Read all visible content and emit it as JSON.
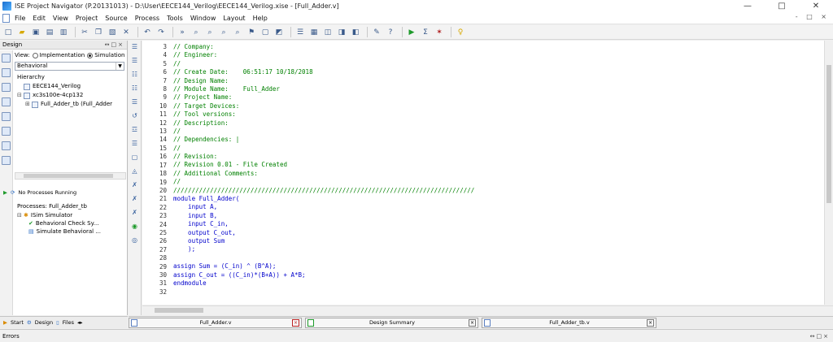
{
  "window": {
    "title": "ISE Project Navigator (P.20131013) - D:\\User\\EECE144_Verilog\\EECE144_Verilog.xise - [Full_Adder.v]",
    "minimize": "—",
    "maximize": "□",
    "close": "✕"
  },
  "menu": {
    "items": [
      "File",
      "Edit",
      "View",
      "Project",
      "Source",
      "Process",
      "Tools",
      "Window",
      "Layout",
      "Help"
    ],
    "mdi_controls": "- □ ×"
  },
  "design_panel": {
    "header": "Design",
    "header_controls": "↔□×",
    "view_label": "View:",
    "view_implementation": "Implementation",
    "view_simulation": "Simulation",
    "selected_view": "Simulation",
    "dropdown_value": "Behavioral",
    "hierarchy_label": "Hierarchy",
    "tree": [
      {
        "toggle": "",
        "label": "EECE144_Verilog"
      },
      {
        "toggle": "⊟",
        "label": "xc3s100e-4cp132"
      },
      {
        "toggle": "⊞",
        "label": "Full_Adder_tb (Full_Adder"
      }
    ]
  },
  "processes": {
    "status": "No Processes Running",
    "label": "Processes: Full_Adder_tb",
    "tree": [
      {
        "toggle": "⊟",
        "label": "ISim Simulator"
      },
      {
        "toggle": "",
        "label": "Behavioral Check Sy..."
      },
      {
        "toggle": "",
        "label": "Simulate Behavioral ..."
      }
    ]
  },
  "editor": {
    "lines": [
      {
        "num": "3",
        "text": "// Company:",
        "kind": "comment"
      },
      {
        "num": "4",
        "text": "// Engineer:",
        "kind": "comment"
      },
      {
        "num": "5",
        "text": "//",
        "kind": "comment"
      },
      {
        "num": "6",
        "text": "// Create Date:    06:51:17 10/18/2018",
        "kind": "comment"
      },
      {
        "num": "7",
        "text": "// Design Name:",
        "kind": "comment"
      },
      {
        "num": "8",
        "text": "// Module Name:    Full_Adder",
        "kind": "comment"
      },
      {
        "num": "9",
        "text": "// Project Name:",
        "kind": "comment"
      },
      {
        "num": "10",
        "text": "// Target Devices:",
        "kind": "comment"
      },
      {
        "num": "11",
        "text": "// Tool versions:",
        "kind": "comment"
      },
      {
        "num": "12",
        "text": "// Description:",
        "kind": "comment"
      },
      {
        "num": "13",
        "text": "//",
        "kind": "comment"
      },
      {
        "num": "14",
        "text": "// Dependencies: |",
        "kind": "comment"
      },
      {
        "num": "15",
        "text": "//",
        "kind": "comment"
      },
      {
        "num": "16",
        "text": "// Revision:",
        "kind": "comment"
      },
      {
        "num": "17",
        "text": "// Revision 0.01 - File Created",
        "kind": "comment"
      },
      {
        "num": "18",
        "text": "// Additional Comments:",
        "kind": "comment"
      },
      {
        "num": "19",
        "text": "//",
        "kind": "comment"
      },
      {
        "num": "20",
        "text": "//////////////////////////////////////////////////////////////////////////////////",
        "kind": "comment"
      },
      {
        "num": "21",
        "text": "module Full_Adder(",
        "kind": "keyword"
      },
      {
        "num": "22",
        "text": "    input A,",
        "kind": "keyword"
      },
      {
        "num": "23",
        "text": "    input B,",
        "kind": "keyword"
      },
      {
        "num": "24",
        "text": "    input C_in,",
        "kind": "keyword"
      },
      {
        "num": "25",
        "text": "    output C_out,",
        "kind": "keyword"
      },
      {
        "num": "26",
        "text": "    output Sum",
        "kind": "keyword"
      },
      {
        "num": "27",
        "text": "    );",
        "kind": "keyword"
      },
      {
        "num": "28",
        "text": "",
        "kind": "text"
      },
      {
        "num": "29",
        "text": "assign Sum = (C_in) ^ (B^A);",
        "kind": "keyword"
      },
      {
        "num": "30",
        "text": "assign C_out = ((C_in)*(B+A)) + A*B;",
        "kind": "keyword"
      },
      {
        "num": "31",
        "text": "endmodule",
        "kind": "keyword"
      },
      {
        "num": "32",
        "text": "",
        "kind": "text"
      }
    ]
  },
  "left_tabs": [
    "Start",
    "Design",
    "Files"
  ],
  "doc_tabs": [
    {
      "label": "Full_Adder.v"
    },
    {
      "label": "Design Summary"
    },
    {
      "label": "Full_Adder_tb.v"
    }
  ],
  "bottom": {
    "errors_label": "Errors",
    "controls": "↔□×"
  }
}
